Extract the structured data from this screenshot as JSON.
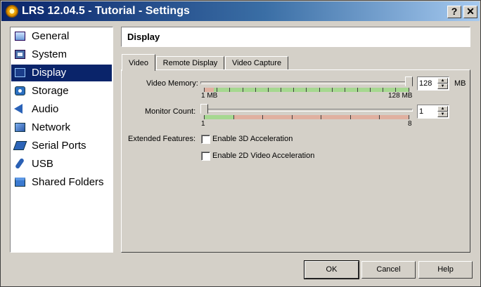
{
  "window": {
    "title": "LRS 12.04.5 - Tutorial - Settings",
    "help_label": "?",
    "close_label": "✕"
  },
  "sidebar": {
    "items": [
      {
        "label": "General",
        "icon": "general-icon"
      },
      {
        "label": "System",
        "icon": "system-icon"
      },
      {
        "label": "Display",
        "icon": "display-icon",
        "selected": true
      },
      {
        "label": "Storage",
        "icon": "storage-icon"
      },
      {
        "label": "Audio",
        "icon": "audio-icon"
      },
      {
        "label": "Network",
        "icon": "network-icon"
      },
      {
        "label": "Serial Ports",
        "icon": "serial-ports-icon"
      },
      {
        "label": "USB",
        "icon": "usb-icon"
      },
      {
        "label": "Shared Folders",
        "icon": "shared-folders-icon"
      }
    ]
  },
  "page": {
    "title": "Display"
  },
  "tabs": [
    {
      "label": "Video",
      "active": true
    },
    {
      "label": "Remote Display",
      "active": false
    },
    {
      "label": "Video Capture",
      "active": false
    }
  ],
  "video": {
    "memory": {
      "label": "Video Memory:",
      "value": "128",
      "unit": "MB",
      "min_label": "1 MB",
      "max_label": "128 MB",
      "level": 1.0
    },
    "monitor": {
      "label": "Monitor Count:",
      "value": "1",
      "min_label": "1",
      "max_label": "8",
      "level": 0.0
    },
    "extended": {
      "label": "Extended Features:",
      "accel_3d": {
        "label": "Enable 3D Acceleration",
        "checked": false
      },
      "accel_2d": {
        "label": "Enable 2D Video Acceleration",
        "checked": false
      }
    }
  },
  "buttons": {
    "ok": "OK",
    "cancel": "Cancel",
    "help": "Help"
  },
  "colors": {
    "selection": "#0a246a",
    "scale_good": "#a6d890",
    "scale_warn": "#e0b0a0"
  }
}
